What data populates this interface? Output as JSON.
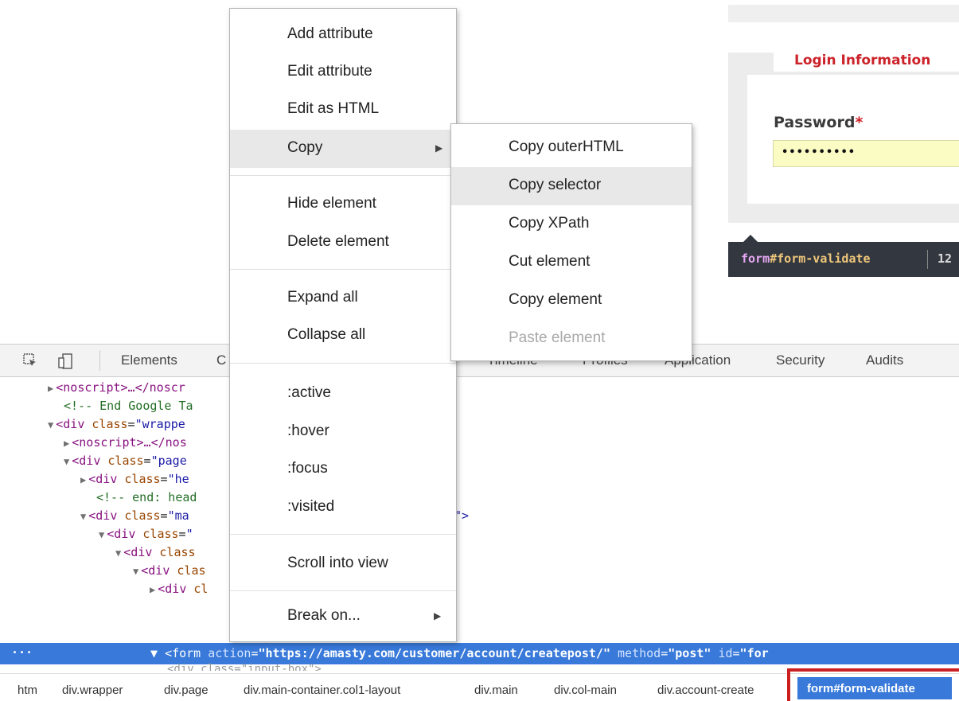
{
  "page": {
    "login_legend": "Login Information",
    "password_label": "Password",
    "required_mark": "*",
    "password_value": "••••••••••",
    "tooltip_selector_tag": "form",
    "tooltip_selector_id": "#form-validate",
    "tooltip_size": "12"
  },
  "devtools": {
    "tabs": [
      "Elements",
      "C",
      "Timeline",
      "Profiles",
      "Application",
      "Security",
      "Audits"
    ],
    "code": [
      {
        "tag": "<noscript>…</noscr"
      },
      {
        "comment": "<!-- End Google Ta"
      },
      {
        "open": "<div ",
        "attr": "class",
        "val": "\"wrappe"
      },
      {
        "tag": "<noscript>…</nos"
      },
      {
        "open": "<div ",
        "attr": "class",
        "val": "\"page"
      },
      {
        "open": "<div ",
        "attr": "class",
        "val": "\"he"
      },
      {
        "comment": "<!-- end: head"
      },
      {
        "open": "<div ",
        "attr": "class",
        "val": "\"ma",
        "tail": "\">"
      },
      {
        "open": "<div ",
        "attr": "class",
        "val": "\""
      },
      {
        "open": "<div ",
        "attr": "class",
        "val": ""
      },
      {
        "open": "<div ",
        "attr": "clas",
        "val": ""
      },
      {
        "open": "<div ",
        "attr": "cl",
        "val": ""
      }
    ],
    "selected_row": {
      "dots": "···",
      "tag_open": "<form ",
      "action_attr": "action",
      "action_val": "\"https://amasty.com/customer/account/createpost/\"",
      "method_attr": "method",
      "method_val": "\"post\"",
      "id_attr": "id",
      "id_val": "\"for"
    },
    "next_line": "<div class=\"input-box\">",
    "breadcrumbs": [
      "htm",
      "div.wrapper",
      "div.page",
      "div.main-container.col1-layout",
      "div.main",
      "div.col-main",
      "div.account-create"
    ],
    "breadcrumb_active": "form#form-validate"
  },
  "context_menu": {
    "items": [
      "Add attribute",
      "Edit attribute",
      "Edit as HTML",
      "Copy",
      "Hide element",
      "Delete element",
      "Expand all",
      "Collapse all",
      ":active",
      ":hover",
      ":focus",
      ":visited",
      "Scroll into view",
      "Break on..."
    ],
    "highlighted": "Copy"
  },
  "copy_submenu": {
    "items": [
      "Copy outerHTML",
      "Copy selector",
      "Copy XPath",
      "Cut element",
      "Copy element",
      "Paste element"
    ],
    "highlighted": "Copy selector",
    "disabled": "Paste element"
  },
  "colors": {
    "selection_blue": "#3879d9",
    "brand_red": "#cc2229",
    "highlight_box_red": "#cc1f1f"
  }
}
